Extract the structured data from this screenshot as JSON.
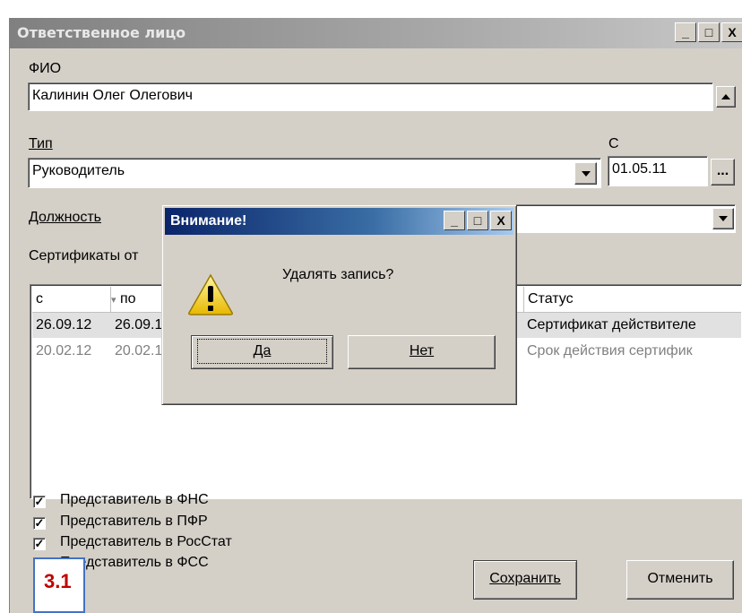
{
  "window": {
    "title": "Ответственное лицо",
    "controls": [
      "_",
      "□",
      "X"
    ]
  },
  "form": {
    "fio_label": "ФИО",
    "fio_value": "Калинин Олег Олегович",
    "type_label": "Тип",
    "type_value": "Руководитель",
    "from_label": "С",
    "from_value": "01.05.11",
    "date_button": "...",
    "position_label": "Должность",
    "certs_label": "Сертификаты от"
  },
  "grid": {
    "headers": [
      "с",
      "по",
      "Статус"
    ],
    "rows": [
      {
        "from": "26.09.12",
        "to": "26.09.1",
        "status": "Сертификат действителе"
      },
      {
        "from": "20.02.12",
        "to": "20.02.1",
        "status": "Срок действия сертифик"
      }
    ]
  },
  "checkboxes": [
    {
      "label": "Представитель в ФНС",
      "checked": true
    },
    {
      "label": "Представитель в ПФР",
      "checked": true
    },
    {
      "label": "Представитель в РосСтат",
      "checked": true
    },
    {
      "label": "Представитель в ФСС",
      "checked": true
    }
  ],
  "buttons": {
    "save": "Сохранить",
    "cancel": "Отменить"
  },
  "dialog": {
    "title": "Внимание!",
    "message": "Удалять запись?",
    "yes": "Да",
    "no": "Нет",
    "icon": "warning-icon"
  },
  "badge": "3.1",
  "colors": {
    "face": "#d4d0c8",
    "dialog_title": "#0a246a",
    "badge_border": "#4472c4",
    "badge_text": "#c00000"
  }
}
